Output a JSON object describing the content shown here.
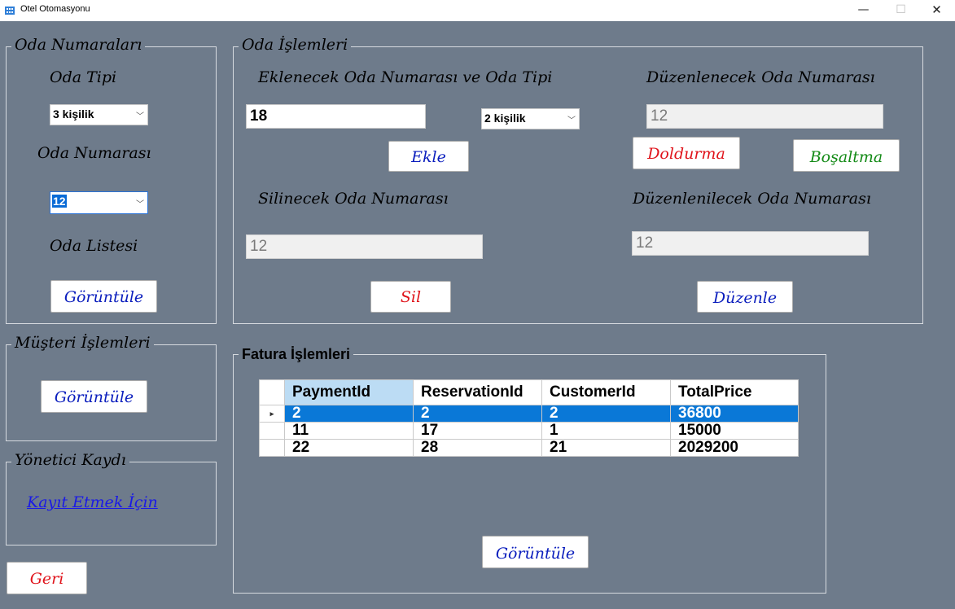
{
  "window": {
    "title": "Otel Otomasyonu",
    "minimize": "—",
    "maximize": "☐",
    "close": "✕"
  },
  "oda_numaralari": {
    "legend": "Oda Numaraları",
    "oda_tipi_label": "Oda Tipi",
    "oda_tipi_value": "3 kişilik",
    "oda_numarasi_label": "Oda Numarası",
    "oda_numarasi_value": "12",
    "oda_listesi_label": "Oda Listesi",
    "goruntule": "Görüntüle"
  },
  "musteri_islemleri": {
    "legend": "Müşteri İşlemleri",
    "goruntule": "Görüntüle"
  },
  "yonetici_kaydi": {
    "legend": "Yönetici Kaydı",
    "link": "Kayıt Etmek İçin"
  },
  "geri": "Geri",
  "oda_islemleri": {
    "legend": "Oda İşlemleri",
    "ekle_label": "Eklenecek Oda Numarası ve Oda Tipi",
    "ekle_numara": "18",
    "ekle_tip": "2 kişilik",
    "ekle_button": "Ekle",
    "duzenlenecek_label": "Düzenlenecek Oda Numarası",
    "duzenlenecek_value": "12",
    "doldurma_button": "Doldurma",
    "bosaltma_button": "Boşaltma",
    "silinecek_label": "Silinecek Oda Numarası",
    "silinecek_value": "12",
    "sil_button": "Sil",
    "duzenlenilecek_label": "Düzenlenilecek Oda Numarası",
    "duzenlenilecek_value": "12",
    "duzenle_button": "Düzenle"
  },
  "fatura_islemleri": {
    "legend": "Fatura İşlemleri",
    "columns": [
      "PaymentId",
      "ReservationId",
      "CustomerId",
      "TotalPrice"
    ],
    "rows": [
      [
        "2",
        "2",
        "2",
        "36800"
      ],
      [
        "11",
        "17",
        "1",
        "15000"
      ],
      [
        "22",
        "28",
        "21",
        "2029200"
      ]
    ],
    "row_pointer": "▸",
    "goruntule": "Görüntüle"
  },
  "colors": {
    "background": "#6e7b8b",
    "blue_text": "#0a1dbd",
    "red_text": "#e0141b",
    "green_text": "#138a16",
    "selection": "#0a78d7"
  }
}
